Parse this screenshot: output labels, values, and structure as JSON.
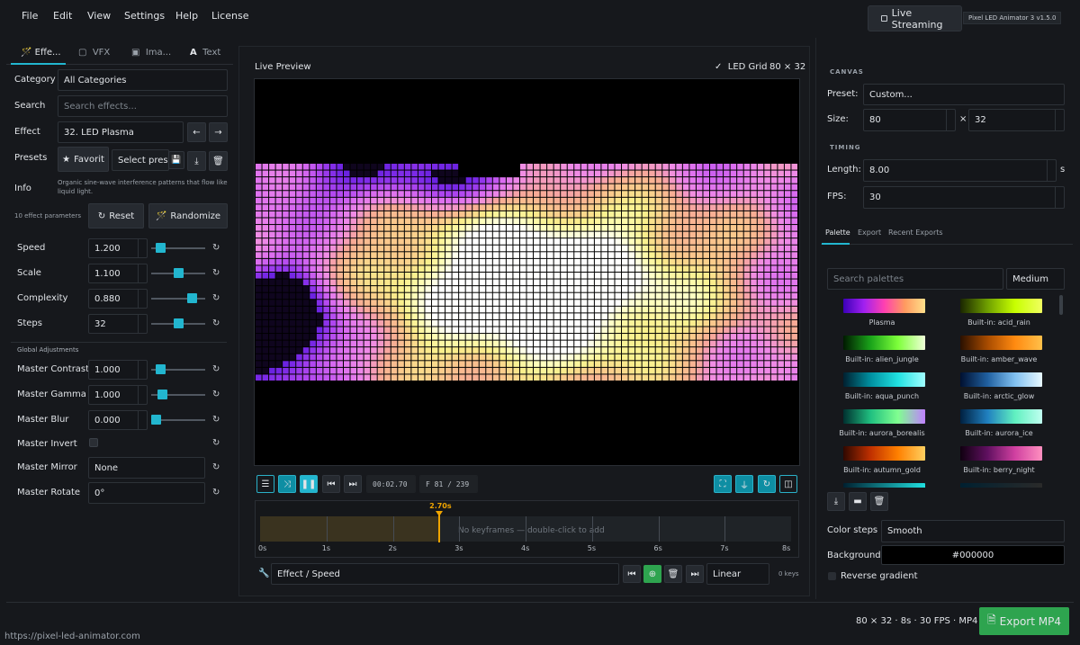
{
  "menu": [
    "File",
    "Edit",
    "View",
    "Settings",
    "Help",
    "License"
  ],
  "header": {
    "stream_label": "Live Streaming",
    "version": "Pixel LED Animator 3  v1.5.0"
  },
  "left_tabs": [
    "Effe...",
    "VFX",
    "Ima...",
    "Text"
  ],
  "left": {
    "category_label": "Category",
    "category_value": "All Categories",
    "search_label": "Search",
    "search_placeholder": "Search effects...",
    "effect_label": "Effect",
    "effect_value": "32. LED Plasma",
    "presets_label": "Presets",
    "favorite_label": "Favorit",
    "preset_select": "Select prese",
    "info_label": "Info",
    "info_text": "Organic sine-wave interference patterns that flow like liquid light.",
    "param_count": "10 effect parameters",
    "reset_label": "Reset",
    "randomize_label": "Randomize",
    "params": [
      {
        "label": "Speed",
        "value": "1.200",
        "level": 0.1
      },
      {
        "label": "Scale",
        "value": "1.100",
        "level": 0.5
      },
      {
        "label": "Complexity",
        "value": "0.880",
        "level": 0.82
      },
      {
        "label": "Steps",
        "value": "32",
        "level": 0.5
      }
    ],
    "global_title": "Global Adjustments",
    "global": [
      {
        "label": "Master Contrast",
        "value": "1.000",
        "level": 0.1
      },
      {
        "label": "Master Gamma",
        "value": "1.000",
        "level": 0.15
      },
      {
        "label": "Master Blur",
        "value": "0.000",
        "level": 0.0
      }
    ],
    "invert_label": "Master Invert",
    "mirror_label": "Master Mirror",
    "mirror_value": "None",
    "rotate_label": "Master Rotate",
    "rotate_value": "0°"
  },
  "preview": {
    "title": "Live Preview",
    "grid_label": "LED Grid",
    "grid_size": "80 × 32",
    "timecode": "00:02.70",
    "frame": "F 81 / 239",
    "playhead": "2.70s",
    "playhead_fraction": 0.3375,
    "keyframe_hint": "No keyframes — double-click to add",
    "ticks": [
      "0s",
      "1s",
      "2s",
      "3s",
      "4s",
      "5s",
      "6s",
      "7s",
      "8s"
    ],
    "track_label": "Effect / Speed",
    "interp": "Linear",
    "keys": "0 keys"
  },
  "right": {
    "canvas_title": "CANVAS",
    "preset_label": "Preset:",
    "preset_value": "Custom...",
    "size_label": "Size:",
    "width": "80",
    "times": "×",
    "height": "32",
    "timing_title": "TIMING",
    "length_label": "Length:",
    "length_value": "8.00",
    "length_unit": "s",
    "fps_label": "FPS:",
    "fps_value": "30",
    "tabs": [
      "Palette",
      "Export",
      "Recent Exports"
    ],
    "palette_search_placeholder": "Search palettes",
    "palette_size": "Medium",
    "palettes": [
      {
        "label": "Plasma",
        "colors": [
          "#3b00b8",
          "#a020f0",
          "#ff40b0",
          "#ff9a60",
          "#ffe08a"
        ]
      },
      {
        "label": "Built-in: acid_rain",
        "colors": [
          "#1a2600",
          "#6fa000",
          "#c8ff00",
          "#f0ff60"
        ]
      },
      {
        "label": "Built-in: alien_jungle",
        "colors": [
          "#001a00",
          "#1aa31a",
          "#7dff3a",
          "#f0ffd8"
        ]
      },
      {
        "label": "Built-in: amber_wave",
        "colors": [
          "#2a1000",
          "#a84b00",
          "#ff8a10",
          "#ffc04a"
        ]
      },
      {
        "label": "Built-in: aqua_punch",
        "colors": [
          "#002030",
          "#0090a0",
          "#20e0e0",
          "#a0ffff"
        ]
      },
      {
        "label": "Built-in: arctic_glow",
        "colors": [
          "#001030",
          "#2060a0",
          "#80c0f0",
          "#e8f8ff"
        ]
      },
      {
        "label": "Built-in: aurora_borealis",
        "colors": [
          "#003030",
          "#20c080",
          "#80ff90",
          "#c080ff"
        ]
      },
      {
        "label": "Built-in: aurora_ice",
        "colors": [
          "#002040",
          "#2080c0",
          "#60f0c0",
          "#c0fff0"
        ]
      },
      {
        "label": "Built-in: autumn_gold",
        "colors": [
          "#300800",
          "#c03000",
          "#ff8000",
          "#ffd060"
        ]
      },
      {
        "label": "Built-in: berry_night",
        "colors": [
          "#100010",
          "#601060",
          "#d040a0",
          "#ff90c0"
        ]
      }
    ],
    "color_steps_label": "Color steps",
    "color_steps_value": "Smooth",
    "background_label": "Background",
    "background_value": "#000000",
    "reverse_label": "Reverse gradient"
  },
  "footer": {
    "url": "https://pixel-led-animator.com",
    "summary": "80 × 32  ·  8s  ·  30 FPS  ·  MP4",
    "export_label": "Export MP4"
  }
}
